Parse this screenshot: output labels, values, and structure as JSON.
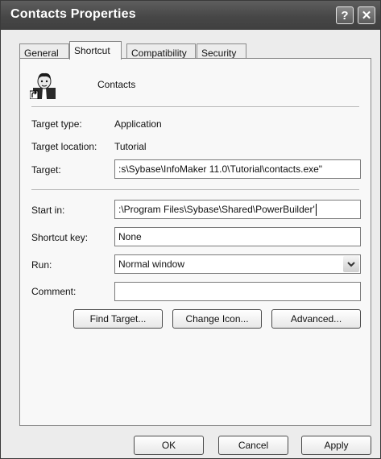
{
  "window": {
    "title": "Contacts Properties",
    "help_label": "?",
    "close_label": "✕"
  },
  "tabs": [
    {
      "label": "General"
    },
    {
      "label": "Shortcut"
    },
    {
      "label": "Compatibility"
    },
    {
      "label": "Security"
    }
  ],
  "shortcut": {
    "name": "Contacts",
    "target_type_label": "Target type:",
    "target_type_value": "Application",
    "target_location_label": "Target location:",
    "target_location_value": "Tutorial",
    "target_label": "Target:",
    "target_value": ":s\\Sybase\\InfoMaker 11.0\\Tutorial\\contacts.exe\"",
    "start_in_label": "Start in:",
    "start_in_value": ":\\Program Files\\Sybase\\Shared\\PowerBuilder'",
    "shortcut_key_label": "Shortcut key:",
    "shortcut_key_value": "None",
    "run_label": "Run:",
    "run_value": "Normal window",
    "comment_label": "Comment:",
    "comment_value": ""
  },
  "buttons": {
    "find_target": "Find Target...",
    "change_icon": "Change Icon...",
    "advanced": "Advanced...",
    "ok": "OK",
    "cancel": "Cancel",
    "apply": "Apply"
  }
}
